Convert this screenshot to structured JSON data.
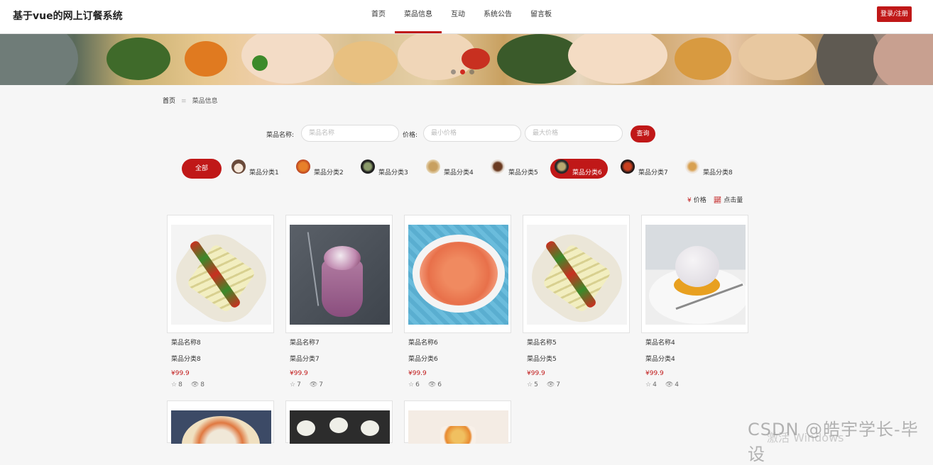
{
  "header": {
    "brand": "基于vue的网上订餐系统",
    "nav": [
      "首页",
      "菜品信息",
      "互动",
      "系统公告",
      "留言板"
    ],
    "active_nav": 1,
    "login": "登录/注册"
  },
  "banner": {
    "slides": 3,
    "active_slide": 1
  },
  "breadcrumb": {
    "home": "首页",
    "sep": "≡",
    "current": "菜品信息"
  },
  "search": {
    "name_label": "菜品名称:",
    "name_placeholder": "菜品名称",
    "price_label": "价格:",
    "min_placeholder": "最小价格",
    "max_placeholder": "最大价格",
    "button": "查询"
  },
  "categories": {
    "all": "全部",
    "items": [
      "菜品分类1",
      "菜品分类2",
      "菜品分类3",
      "菜品分类4",
      "菜品分类5",
      "菜品分类6",
      "菜品分类7",
      "菜品分类8"
    ],
    "active": 5
  },
  "sort": {
    "price_icon": "¥",
    "price": "价格",
    "clicks_icon": "trend-icon",
    "clicks": "点击量"
  },
  "products": [
    {
      "name": "菜品名称8",
      "category": "菜品分类8",
      "price": "¥99.9",
      "stars": "8",
      "views": "8"
    },
    {
      "name": "菜品名称7",
      "category": "菜品分类7",
      "price": "¥99.9",
      "stars": "7",
      "views": "7"
    },
    {
      "name": "菜品名称6",
      "category": "菜品分类6",
      "price": "¥99.9",
      "stars": "6",
      "views": "6"
    },
    {
      "name": "菜品名称5",
      "category": "菜品分类5",
      "price": "¥99.9",
      "stars": "5",
      "views": "7"
    },
    {
      "name": "菜品名称4",
      "category": "菜品分类4",
      "price": "¥99.9",
      "stars": "4",
      "views": "4"
    }
  ],
  "watermark": {
    "csdn": "CSDN @皓宇学长-毕设",
    "windows": "激活 Windows"
  },
  "colors": {
    "accent": "#c01818"
  }
}
